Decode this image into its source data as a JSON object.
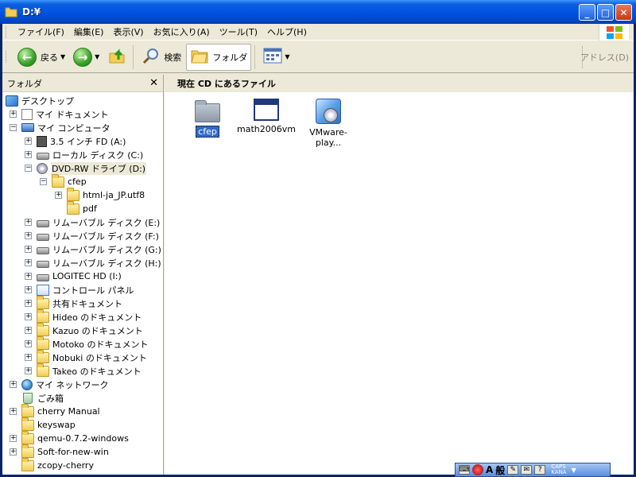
{
  "window": {
    "title": "D:¥",
    "controls": {
      "minimize": "_",
      "maximize": "□",
      "close": "✕"
    }
  },
  "menu": {
    "items": [
      "ファイル(F)",
      "編集(E)",
      "表示(V)",
      "お気に入り(A)",
      "ツール(T)",
      "ヘルプ(H)"
    ]
  },
  "toolbar": {
    "back_label": "戻る",
    "search_label": "検索",
    "folders_label": "フォルダ",
    "address_label": "アドレス(D)"
  },
  "folder_pane": {
    "title": "フォルダ",
    "close_glyph": "✕",
    "tree": [
      {
        "label": "デスクトップ",
        "level": 0,
        "expander": "none",
        "icon": "desktop-icon"
      },
      {
        "label": "マイ ドキュメント",
        "level": 1,
        "expander": "+",
        "icon": "my-documents-icon"
      },
      {
        "label": "マイ コンピュータ",
        "level": 1,
        "expander": "-",
        "icon": "my-computer-icon"
      },
      {
        "label": "3.5 インチ FD (A:)",
        "level": 2,
        "expander": "+",
        "icon": "floppy-drive-icon"
      },
      {
        "label": "ローカル ディスク (C:)",
        "level": 2,
        "expander": "+",
        "icon": "hard-disk-icon"
      },
      {
        "label": "DVD-RW ドライブ (D:)",
        "level": 2,
        "expander": "-",
        "icon": "dvd-drive-icon",
        "selected": true
      },
      {
        "label": "cfep",
        "level": 3,
        "expander": "-",
        "icon": "folder-icon"
      },
      {
        "label": "html-ja_JP.utf8",
        "level": 4,
        "expander": "+",
        "icon": "folder-icon"
      },
      {
        "label": "pdf",
        "level": 4,
        "expander": "none",
        "icon": "folder-icon"
      },
      {
        "label": "リムーバブル ディスク (E:)",
        "level": 2,
        "expander": "+",
        "icon": "removable-disk-icon"
      },
      {
        "label": "リムーバブル ディスク (F:)",
        "level": 2,
        "expander": "+",
        "icon": "removable-disk-icon"
      },
      {
        "label": "リムーバブル ディスク (G:)",
        "level": 2,
        "expander": "+",
        "icon": "removable-disk-icon"
      },
      {
        "label": "リムーバブル ディスク (H:)",
        "level": 2,
        "expander": "+",
        "icon": "removable-disk-icon"
      },
      {
        "label": "LOGITEC HD (I:)",
        "level": 2,
        "expander": "+",
        "icon": "hard-disk-icon"
      },
      {
        "label": "コントロール パネル",
        "level": 2,
        "expander": "+",
        "icon": "control-panel-icon"
      },
      {
        "label": "共有ドキュメント",
        "level": 2,
        "expander": "+",
        "icon": "folder-icon"
      },
      {
        "label": "Hideo のドキュメント",
        "level": 2,
        "expander": "+",
        "icon": "folder-icon"
      },
      {
        "label": "Kazuo のドキュメント",
        "level": 2,
        "expander": "+",
        "icon": "folder-icon"
      },
      {
        "label": "Motoko のドキュメント",
        "level": 2,
        "expander": "+",
        "icon": "folder-icon"
      },
      {
        "label": "Nobuki のドキュメント",
        "level": 2,
        "expander": "+",
        "icon": "folder-icon"
      },
      {
        "label": "Takeo のドキュメント",
        "level": 2,
        "expander": "+",
        "icon": "folder-icon"
      },
      {
        "label": "マイ ネットワーク",
        "level": 1,
        "expander": "+",
        "icon": "network-icon"
      },
      {
        "label": "ごみ箱",
        "level": 1,
        "expander": "none",
        "icon": "recycle-bin-icon"
      },
      {
        "label": "cherry Manual",
        "level": 1,
        "expander": "+",
        "icon": "folder-icon"
      },
      {
        "label": "keyswap",
        "level": 1,
        "expander": "none",
        "icon": "folder-icon"
      },
      {
        "label": "qemu-0.7.2-windows",
        "level": 1,
        "expander": "+",
        "icon": "folder-icon"
      },
      {
        "label": "Soft-for-new-win",
        "level": 1,
        "expander": "+",
        "icon": "folder-icon"
      },
      {
        "label": "zcopy-cherry",
        "level": 1,
        "expander": "none",
        "icon": "folder-icon"
      }
    ]
  },
  "main": {
    "header": "現在 CD にあるファイル",
    "files": [
      {
        "label": "cfep",
        "icon": "folder-icon",
        "selected": true
      },
      {
        "label": "math2006vm",
        "icon": "application-window-icon",
        "selected": false
      },
      {
        "label": "VMware-play...",
        "icon": "vmware-player-icon",
        "selected": false
      }
    ]
  },
  "language_bar": {
    "ime_mode": "A",
    "kana": "般",
    "caps": "CAPS",
    "kana_lock": "KANA",
    "help": "?"
  },
  "colors": {
    "title_blue": "#0054e3",
    "chrome": "#ece9d8",
    "selection": "#316ac5"
  }
}
